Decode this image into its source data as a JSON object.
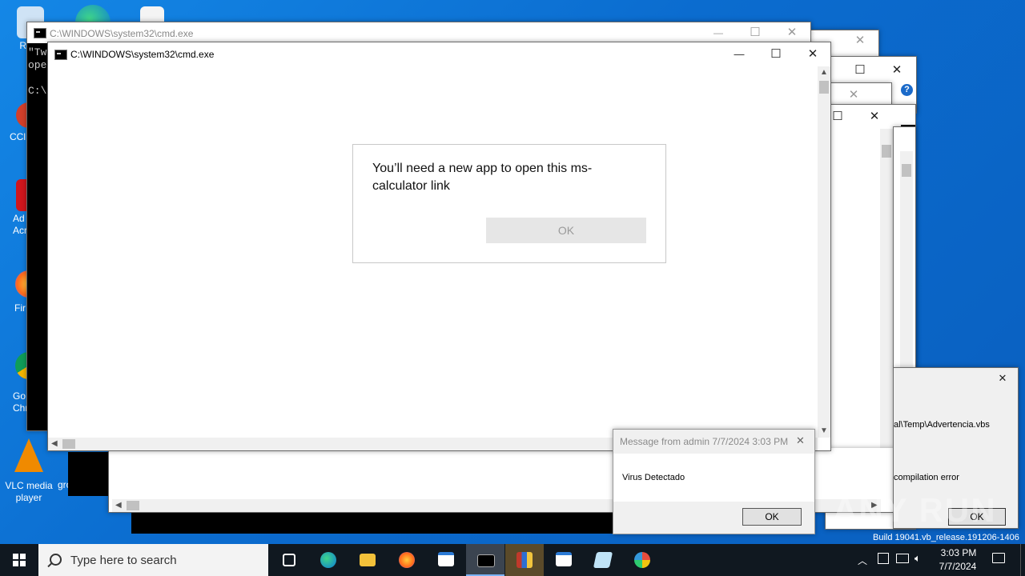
{
  "desktop": {
    "icons": [
      {
        "label": "Recy"
      },
      {
        "label": "CCl"
      },
      {
        "label": "Ad Acr"
      },
      {
        "label": "Fir"
      },
      {
        "label": "Go Chr"
      },
      {
        "label": "VLC media player"
      },
      {
        "label": "groun"
      }
    ],
    "watermark": "ANY RUN",
    "build_text": "Build 19041.vb_release.191206-1406"
  },
  "cmd_back": {
    "title": "C:\\WINDOWS\\system32\\cmd.exe",
    "lines": [
      "\"Tw",
      "ope",
      "",
      "C:\\"
    ]
  },
  "cmd_front": {
    "title": "C:\\WINDOWS\\system32\\cmd.exe"
  },
  "app_dialog": {
    "message": "You’ll need a new app to open this ms-calculator link",
    "ok_label": "OK"
  },
  "message_box": {
    "title": "Message from admin 7/7/2024 3:03 PM",
    "body": "Virus Detectado",
    "ok_label": "OK"
  },
  "wsh_error": {
    "path_text": "al\\Temp\\Advertencia.vbs",
    "error_text": "compilation error",
    "ok_label": "OK"
  },
  "window_controls": {
    "minimize": "—",
    "maximize": "☐",
    "close": "✕",
    "help": "?"
  },
  "taskbar": {
    "search_placeholder": "Type here to search",
    "time": "3:03 PM",
    "date": "7/7/2024",
    "apps": [
      "task-view",
      "edge",
      "file-explorer",
      "firefox",
      "window-app",
      "cmd",
      "winrar",
      "window-app-2",
      "notepad",
      "paint"
    ],
    "active_app": "cmd"
  }
}
